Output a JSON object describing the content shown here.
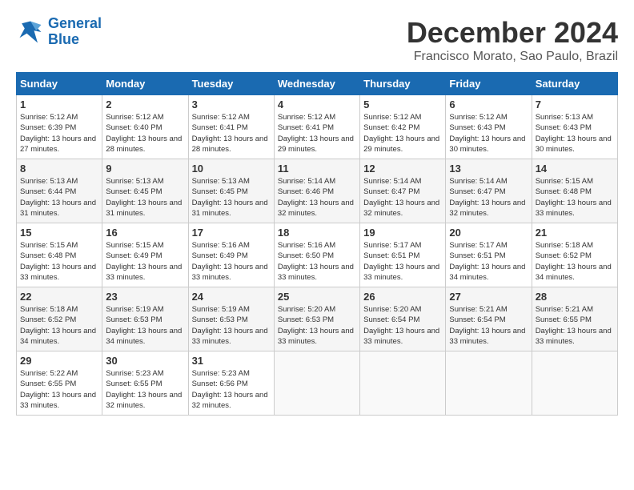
{
  "logo": {
    "line1": "General",
    "line2": "Blue"
  },
  "title": "December 2024",
  "location": "Francisco Morato, Sao Paulo, Brazil",
  "weekdays": [
    "Sunday",
    "Monday",
    "Tuesday",
    "Wednesday",
    "Thursday",
    "Friday",
    "Saturday"
  ],
  "weeks": [
    [
      {
        "day": "1",
        "sunrise": "5:12 AM",
        "sunset": "6:39 PM",
        "daylight": "13 hours and 27 minutes."
      },
      {
        "day": "2",
        "sunrise": "5:12 AM",
        "sunset": "6:40 PM",
        "daylight": "13 hours and 28 minutes."
      },
      {
        "day": "3",
        "sunrise": "5:12 AM",
        "sunset": "6:41 PM",
        "daylight": "13 hours and 28 minutes."
      },
      {
        "day": "4",
        "sunrise": "5:12 AM",
        "sunset": "6:41 PM",
        "daylight": "13 hours and 29 minutes."
      },
      {
        "day": "5",
        "sunrise": "5:12 AM",
        "sunset": "6:42 PM",
        "daylight": "13 hours and 29 minutes."
      },
      {
        "day": "6",
        "sunrise": "5:12 AM",
        "sunset": "6:43 PM",
        "daylight": "13 hours and 30 minutes."
      },
      {
        "day": "7",
        "sunrise": "5:13 AM",
        "sunset": "6:43 PM",
        "daylight": "13 hours and 30 minutes."
      }
    ],
    [
      {
        "day": "8",
        "sunrise": "5:13 AM",
        "sunset": "6:44 PM",
        "daylight": "13 hours and 31 minutes."
      },
      {
        "day": "9",
        "sunrise": "5:13 AM",
        "sunset": "6:45 PM",
        "daylight": "13 hours and 31 minutes."
      },
      {
        "day": "10",
        "sunrise": "5:13 AM",
        "sunset": "6:45 PM",
        "daylight": "13 hours and 31 minutes."
      },
      {
        "day": "11",
        "sunrise": "5:14 AM",
        "sunset": "6:46 PM",
        "daylight": "13 hours and 32 minutes."
      },
      {
        "day": "12",
        "sunrise": "5:14 AM",
        "sunset": "6:47 PM",
        "daylight": "13 hours and 32 minutes."
      },
      {
        "day": "13",
        "sunrise": "5:14 AM",
        "sunset": "6:47 PM",
        "daylight": "13 hours and 32 minutes."
      },
      {
        "day": "14",
        "sunrise": "5:15 AM",
        "sunset": "6:48 PM",
        "daylight": "13 hours and 33 minutes."
      }
    ],
    [
      {
        "day": "15",
        "sunrise": "5:15 AM",
        "sunset": "6:48 PM",
        "daylight": "13 hours and 33 minutes."
      },
      {
        "day": "16",
        "sunrise": "5:15 AM",
        "sunset": "6:49 PM",
        "daylight": "13 hours and 33 minutes."
      },
      {
        "day": "17",
        "sunrise": "5:16 AM",
        "sunset": "6:49 PM",
        "daylight": "13 hours and 33 minutes."
      },
      {
        "day": "18",
        "sunrise": "5:16 AM",
        "sunset": "6:50 PM",
        "daylight": "13 hours and 33 minutes."
      },
      {
        "day": "19",
        "sunrise": "5:17 AM",
        "sunset": "6:51 PM",
        "daylight": "13 hours and 33 minutes."
      },
      {
        "day": "20",
        "sunrise": "5:17 AM",
        "sunset": "6:51 PM",
        "daylight": "13 hours and 34 minutes."
      },
      {
        "day": "21",
        "sunrise": "5:18 AM",
        "sunset": "6:52 PM",
        "daylight": "13 hours and 34 minutes."
      }
    ],
    [
      {
        "day": "22",
        "sunrise": "5:18 AM",
        "sunset": "6:52 PM",
        "daylight": "13 hours and 34 minutes."
      },
      {
        "day": "23",
        "sunrise": "5:19 AM",
        "sunset": "6:53 PM",
        "daylight": "13 hours and 34 minutes."
      },
      {
        "day": "24",
        "sunrise": "5:19 AM",
        "sunset": "6:53 PM",
        "daylight": "13 hours and 33 minutes."
      },
      {
        "day": "25",
        "sunrise": "5:20 AM",
        "sunset": "6:53 PM",
        "daylight": "13 hours and 33 minutes."
      },
      {
        "day": "26",
        "sunrise": "5:20 AM",
        "sunset": "6:54 PM",
        "daylight": "13 hours and 33 minutes."
      },
      {
        "day": "27",
        "sunrise": "5:21 AM",
        "sunset": "6:54 PM",
        "daylight": "13 hours and 33 minutes."
      },
      {
        "day": "28",
        "sunrise": "5:21 AM",
        "sunset": "6:55 PM",
        "daylight": "13 hours and 33 minutes."
      }
    ],
    [
      {
        "day": "29",
        "sunrise": "5:22 AM",
        "sunset": "6:55 PM",
        "daylight": "13 hours and 33 minutes."
      },
      {
        "day": "30",
        "sunrise": "5:23 AM",
        "sunset": "6:55 PM",
        "daylight": "13 hours and 32 minutes."
      },
      {
        "day": "31",
        "sunrise": "5:23 AM",
        "sunset": "6:56 PM",
        "daylight": "13 hours and 32 minutes."
      },
      null,
      null,
      null,
      null
    ]
  ]
}
